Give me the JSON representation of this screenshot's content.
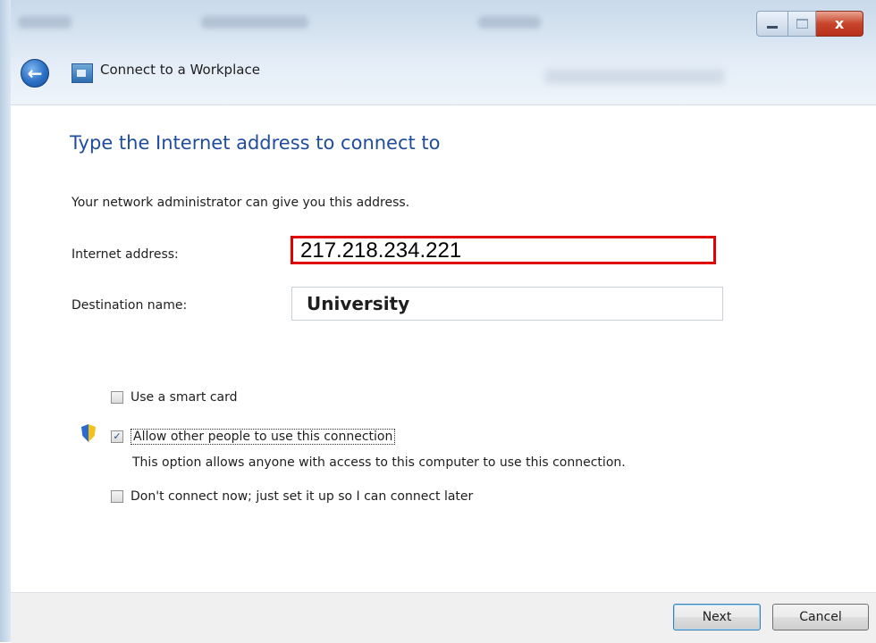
{
  "window": {
    "title": "Connect to a Workplace",
    "close_glyph": "x"
  },
  "icons": {
    "back": "back-arrow-icon",
    "app": "network-icon",
    "shield": "uac-shield-icon"
  },
  "page": {
    "heading": "Type the Internet address to connect to",
    "subtext": "Your network administrator can give you this address."
  },
  "fields": {
    "internet_address_label": "Internet address:",
    "internet_address_value": "217.218.234.221",
    "destination_name_label": "Destination name:",
    "destination_name_value": "University"
  },
  "options": {
    "smart_card": {
      "label": "Use a smart card",
      "checked": false
    },
    "allow_others": {
      "label": "Allow other people to use this connection",
      "checked": true,
      "description": "This option allows anyone with access to this computer to use this connection."
    },
    "connect_later": {
      "label": "Don't connect now; just set it up so I can connect later",
      "checked": false
    }
  },
  "buttons": {
    "next": "Next",
    "cancel": "Cancel"
  },
  "colors": {
    "heading": "#1f4c9e",
    "highlight_border": "#e00000"
  }
}
